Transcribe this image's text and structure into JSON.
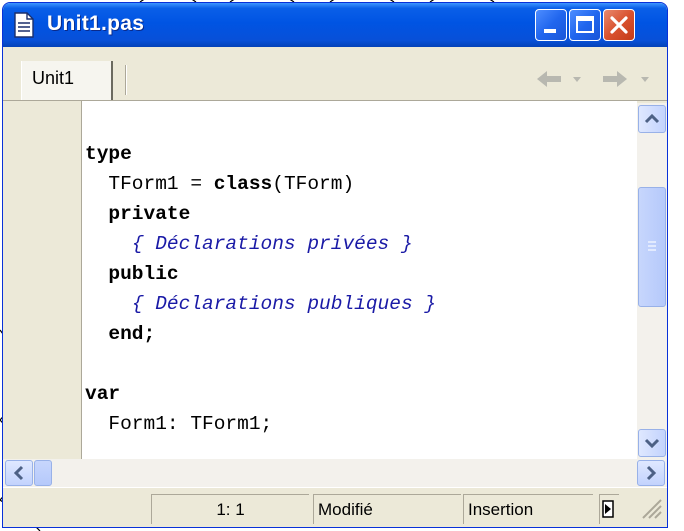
{
  "window": {
    "title": "Unit1.pas",
    "icon": "document-icon",
    "controls": {
      "minimize": "minimize-icon",
      "maximize": "maximize-icon",
      "close": "close-icon"
    }
  },
  "tabs": [
    {
      "label": "Unit1",
      "active": true
    }
  ],
  "nav": {
    "back": "arrow-left-icon",
    "forward": "arrow-right-icon"
  },
  "code_lines": [
    {
      "parts": [
        {
          "t": "type",
          "k": "kw"
        }
      ]
    },
    {
      "parts": [
        {
          "t": "  TForm1 = "
        },
        {
          "t": "class",
          "k": "kw"
        },
        {
          "t": "(TForm)"
        }
      ]
    },
    {
      "parts": [
        {
          "t": "  "
        },
        {
          "t": "private",
          "k": "kw"
        }
      ]
    },
    {
      "parts": [
        {
          "t": "    "
        },
        {
          "t": "{ Déclarations privées }",
          "k": "cm"
        }
      ]
    },
    {
      "parts": [
        {
          "t": "  "
        },
        {
          "t": "public",
          "k": "kw"
        }
      ]
    },
    {
      "parts": [
        {
          "t": "    "
        },
        {
          "t": "{ Déclarations publiques }",
          "k": "cm"
        }
      ]
    },
    {
      "parts": [
        {
          "t": "  "
        },
        {
          "t": "end;",
          "k": "kw"
        }
      ]
    },
    {
      "parts": [
        {
          "t": ""
        }
      ]
    },
    {
      "parts": [
        {
          "t": "var",
          "k": "kw"
        }
      ]
    },
    {
      "parts": [
        {
          "t": "  Form1: TForm1;"
        }
      ]
    }
  ],
  "status": {
    "position": "1:  1",
    "modified": "Modifié",
    "mode": "Insertion"
  },
  "colors": {
    "titlebar": "#0054e3",
    "keyword": "#000000",
    "comment": "#1a1aa6",
    "chrome": "#ece9d8"
  }
}
